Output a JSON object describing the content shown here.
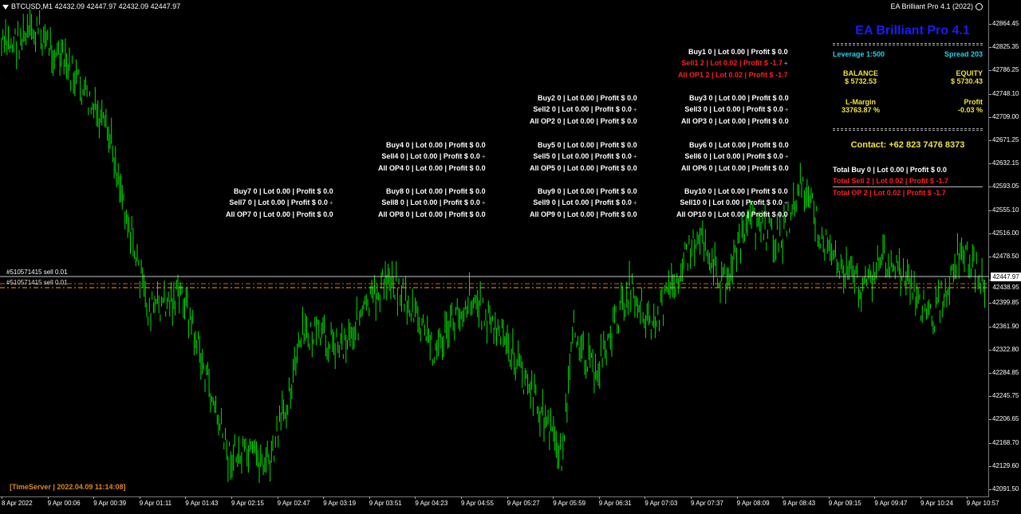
{
  "header": {
    "symbol_line": "BTCUSD,M1  42432.09 42447.97 42432.09 42447.97",
    "ea_label": "EA Brilliant Pro 4.1 (2022)"
  },
  "y_axis": [
    "42864.45",
    "42825.35",
    "42786.25",
    "42748.10",
    "42709.00",
    "42671.25",
    "42632.15",
    "42593.05",
    "42555.10",
    "42516.00",
    "42478.50",
    "42438.95",
    "42399.85",
    "42361.90",
    "42322.80",
    "42284.85",
    "42245.75",
    "42206.65",
    "42168.70",
    "42129.60",
    "42091.50"
  ],
  "x_axis": [
    "8 Apr 2022",
    "9 Apr 00:06",
    "9 Apr 00:39",
    "9 Apr 01:11",
    "9 Apr 01:43",
    "9 Apr 02:15",
    "9 Apr 02:47",
    "9 Apr 03:19",
    "9 Apr 03:51",
    "9 Apr 04:23",
    "9 Apr 04:55",
    "9 Apr 05:27",
    "9 Apr 05:59",
    "9 Apr 06:31",
    "9 Apr 07:03",
    "9 Apr 07:37",
    "9 Apr 08:09",
    "9 Apr 08:43",
    "9 Apr 09:15",
    "9 Apr 09:47",
    "9 Apr 10:24",
    "9 Apr 10:57"
  ],
  "price_tags": {
    "current": "42447.97",
    "line2": "42438.95"
  },
  "order_labels": [
    "#510571415 sell 0.01",
    "#510571415 sell 0.01"
  ],
  "blocks": {
    "b1": {
      "buy": "Buy1  0  |  Lot 0.00  |  Profit $ 0.0",
      "sell": "Sell1  2  |  Lot 0.02  |  Profit $ -1.7",
      "all": "All OP1  2  |  Lot 0.02  |  Profit $ -1.7"
    },
    "b2": {
      "buy": "Buy2  0  |  Lot 0.00  |  Profit $ 0.0",
      "sell": "Sell2  0  |  Lot 0.00  |  Profit $ 0.0",
      "all": "All OP2  0  |  Lot 0.00  |  Profit $ 0.0"
    },
    "b3": {
      "buy": "Buy3  0  |  Lot 0.00  |  Profit $ 0.0",
      "sell": "Sell3  0  |  Lot 0.00  |  Profit $ 0.0",
      "all": "All OP3  0  |  Lot 0.00  |  Profit $ 0.0"
    },
    "b4": {
      "buy": "Buy4  0  |  Lot 0.00  |  Profit $ 0.0",
      "sell": "Sell4  0  |  Lot 0.00  |  Profit $ 0.0",
      "all": "All OP4  0  |  Lot 0.00  |  Profit $ 0.0"
    },
    "b5": {
      "buy": "Buy5  0  |  Lot 0.00  |  Profit $ 0.0",
      "sell": "Sell5  0  |  Lot 0.00  |  Profit $ 0.0",
      "all": "All OP5  0  |  Lot 0.00  |  Profit $ 0.0"
    },
    "b6": {
      "buy": "Buy6  0  |  Lot 0.00  |  Profit $ 0.0",
      "sell": "Sell6  0  |  Lot 0.00  |  Profit $ 0.0",
      "all": "All OP6  0  |  Lot 0.00  |  Profit $ 0.0"
    },
    "b7": {
      "buy": "Buy7  0  |  Lot 0.00  |  Profit $ 0.0",
      "sell": "Sell7  0  |  Lot 0.00  |  Profit $ 0.0",
      "all": "All OP7  0  |  Lot 0.00  |  Profit $ 0.0"
    },
    "b8": {
      "buy": "Buy8  0  |  Lot 0.00  |  Profit $ 0.0",
      "sell": "Sell8  0  |  Lot 0.00  |  Profit $ 0.0",
      "all": "All OP8  0  |  Lot 0.00  |  Profit $ 0.0"
    },
    "b9": {
      "buy": "Buy9  0  |  Lot 0.00  |  Profit $ 0.0",
      "sell": "Sell9  0  |  Lot 0.00  |  Profit $ 0.0",
      "all": "All OP9  0  |  Lot 0.00  |  Profit $ 0.0"
    },
    "b10": {
      "buy": "Buy10  0  |  Lot 0.00  |  Profit $ 0.0",
      "sell": "Sell10  0  |  Lot 0.00  |  Profit $ 0.0",
      "all": "All OP10  0  |  Lot 0.00  |  Profit $ 0.0"
    }
  },
  "panel": {
    "title": "EA Brilliant Pro 4.1",
    "leverage_label": "Leverage  1:500",
    "spread_label": "Spread  203",
    "balance_label": "BALANCE",
    "balance_value": "$ 5732.53",
    "equity_label": "EQUITY",
    "equity_value": "$ 5730.43",
    "margin_label": "L-Margin",
    "margin_value": "33763.87 %",
    "profit_label": "Profit",
    "profit_value": "-0.03 %",
    "contact": "Contact: +62 823 7476 8373",
    "total_buy": "Total Buy  0  |  Lot 0.00  |  Profit $ 0.0",
    "total_sell": "Total Sell  2  |  Lot 0.02  |  Profit $ -1.7",
    "total_op": "Total OP  2  |  Lot 0.02  |  Profit $ -1.7"
  },
  "timeserver": "[TimeServer | 2022.04.09 11:14:08]",
  "colors": {
    "candles": "#00e000",
    "bid_line": "#c8c8c8",
    "order_line": "#e05a10",
    "dotted_line": "#e0b020"
  }
}
